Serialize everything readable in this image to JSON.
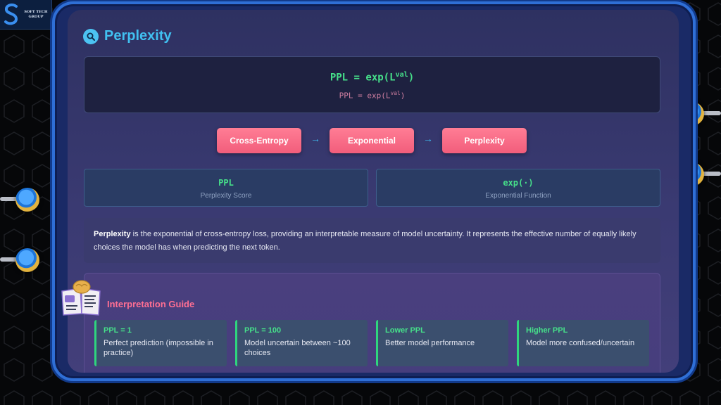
{
  "branding": {
    "logo_line1": "SOFT TECH",
    "logo_line2": "GROUP"
  },
  "header": {
    "title": "Perplexity",
    "icon": "search-icon"
  },
  "formula": {
    "main_prefix": "PPL = exp(L",
    "main_sup": "val",
    "main_suffix": ")",
    "sub_prefix": "PPL = exp(L",
    "sub_sup": "val",
    "sub_suffix": ")"
  },
  "flow": {
    "steps": [
      "Cross-Entropy",
      "Exponential",
      "Perplexity"
    ],
    "arrow": "→"
  },
  "metrics": [
    {
      "symbol": "PPL",
      "label": "Perplexity Score"
    },
    {
      "symbol": "exp(·)",
      "label": "Exponential Function"
    }
  ],
  "description": {
    "term": "Perplexity",
    "text": " is the exponential of cross-entropy loss, providing an interpretable measure of model uncertainty. It represents the effective number of equally likely choices the model has when predicting the next token."
  },
  "guide": {
    "title": "Interpretation Guide",
    "cards": [
      {
        "title": "PPL = 1",
        "text": "Perfect prediction (impossible in practice)"
      },
      {
        "title": "PPL = 100",
        "text": "Model uncertain between ~100 choices"
      },
      {
        "title": "Lower PPL",
        "text": "Better model performance"
      },
      {
        "title": "Higher PPL",
        "text": "Model more confused/uncertain"
      }
    ]
  },
  "colors": {
    "accent_blue": "#41c0f0",
    "formula_green": "#46e08a",
    "button_pink": "#f25d7b",
    "guide_title_pink": "#ff6f93"
  }
}
